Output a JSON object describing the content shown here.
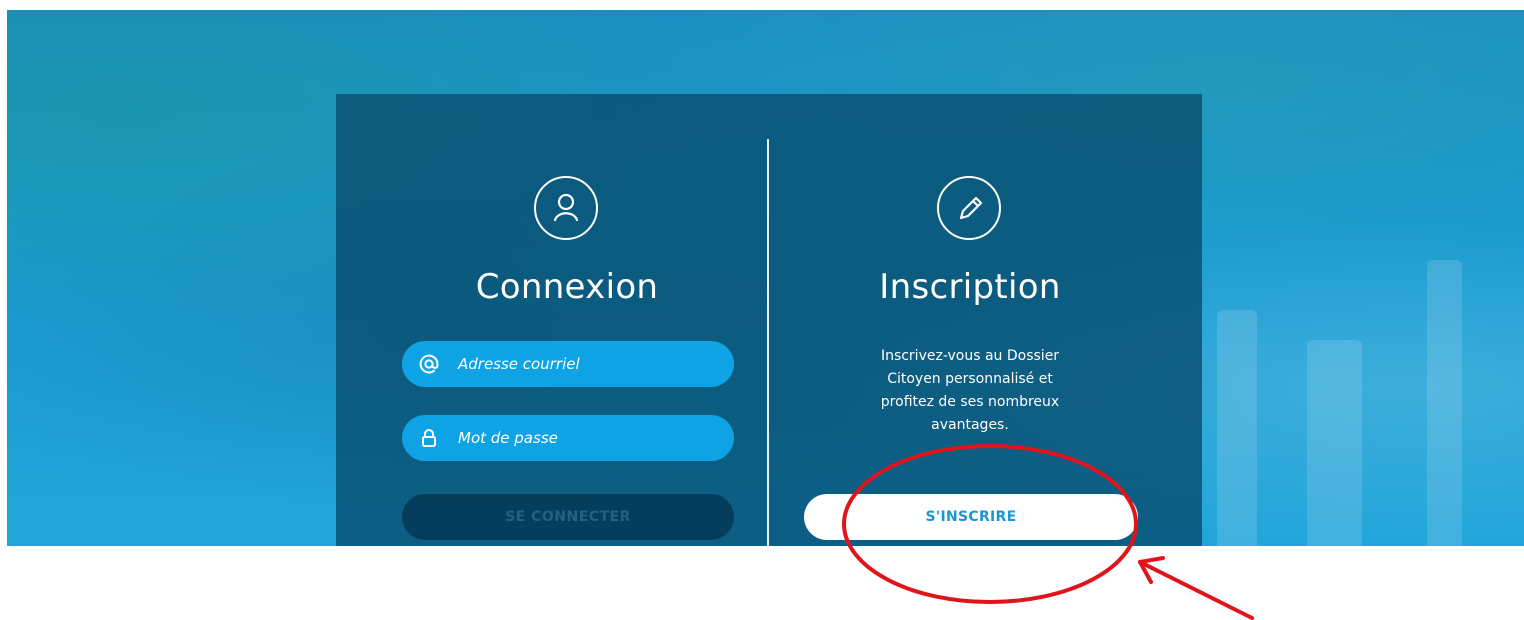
{
  "login": {
    "title": "Connexion",
    "email_placeholder": "Adresse courriel",
    "password_placeholder": "Mot de passe",
    "submit_label": "SE CONNECTER",
    "icons": [
      "user-icon",
      "at-sign-icon",
      "lock-icon"
    ]
  },
  "signup": {
    "title": "Inscription",
    "description": "Inscrivez-vous au Dossier Citoyen personnalisé et profitez de ses nombreux avantages.",
    "button_label": "S'INSCRIRE",
    "icons": [
      "pencil-icon"
    ]
  },
  "colors": {
    "background_blue": "#1a9ad1",
    "panel": "#084a6c",
    "input_fill": "#0ea3e5",
    "signup_text": "#1a97d2",
    "annotation_red": "#e0141b"
  }
}
